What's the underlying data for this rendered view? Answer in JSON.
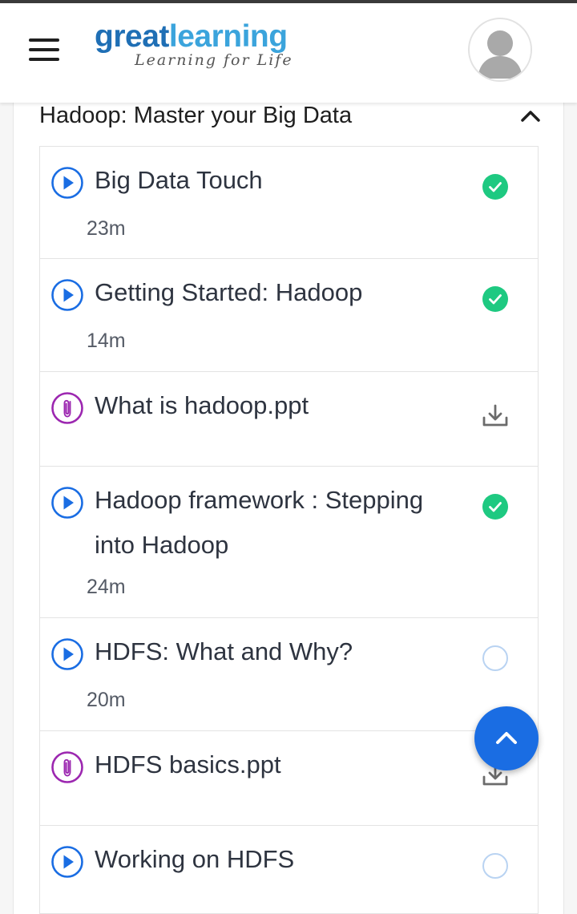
{
  "header": {
    "logo_great": "great",
    "logo_learning": "learning",
    "logo_tagline": "Learning for Life",
    "menu_icon": "hamburger-menu-icon",
    "avatar_icon": "user-avatar-icon"
  },
  "section": {
    "title": "Hadoop: Master your Big Data",
    "toggle_icon": "chevron-up-icon"
  },
  "lessons": [
    {
      "type": "video",
      "title": "Big Data Touch",
      "duration": "23m",
      "status": "completed"
    },
    {
      "type": "video",
      "title": "Getting Started: Hadoop",
      "duration": "14m",
      "status": "completed"
    },
    {
      "type": "attachment",
      "title": "What is hadoop.ppt",
      "duration": "",
      "status": "download"
    },
    {
      "type": "video",
      "title": "Hadoop framework : Stepping into Hadoop",
      "duration": "24m",
      "status": "completed"
    },
    {
      "type": "video",
      "title": "HDFS: What and Why?",
      "duration": "20m",
      "status": "not-started"
    },
    {
      "type": "attachment",
      "title": "HDFS basics.ppt",
      "duration": "",
      "status": "download"
    },
    {
      "type": "video",
      "title": "Working on HDFS",
      "duration": "",
      "status": "not-started"
    }
  ],
  "fab": {
    "icon": "scroll-to-top-icon"
  },
  "colors": {
    "brand_dark": "#1f6fb5",
    "brand_light": "#3ba4dc",
    "play_blue": "#1a6de3",
    "attachment_purple": "#9c27b0",
    "complete_green": "#1ec981",
    "pending_circle": "#b9d3f2"
  }
}
